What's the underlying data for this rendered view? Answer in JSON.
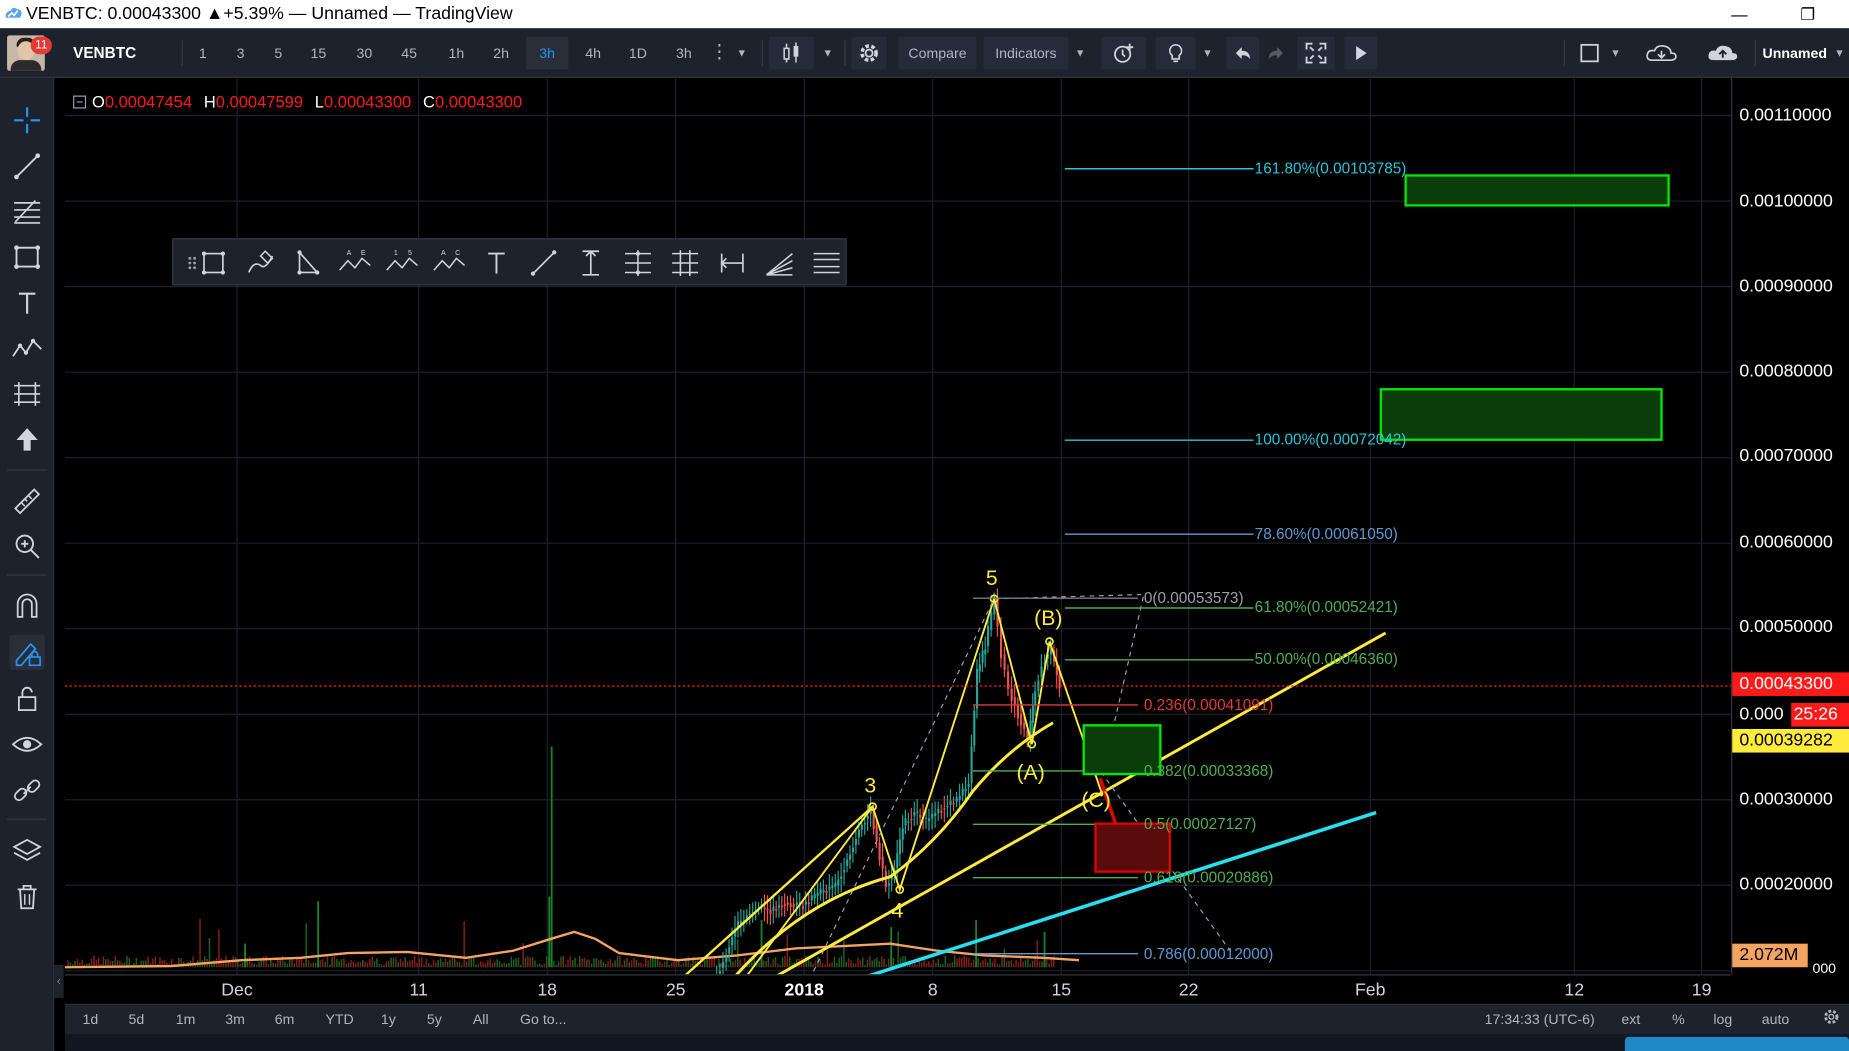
{
  "window": {
    "title": "VENBTC: 0.00043300 ▲+5.39% — Unnamed — TradingView",
    "minimize": "—",
    "restore": "❐"
  },
  "user": {
    "notifications": "11"
  },
  "toolbar": {
    "symbol": "VENBTC",
    "intervals": [
      "1",
      "3",
      "5",
      "15",
      "30",
      "45",
      "1h",
      "2h",
      "3h",
      "4h",
      "1D",
      "3h"
    ],
    "active_interval": "3h",
    "compare_label": "Compare",
    "indicators_label": "Indicators",
    "layout_name": "Unnamed"
  },
  "ohlc": {
    "o_label": "O",
    "o": "0.00047454",
    "h_label": "H",
    "h": "0.00047599",
    "l_label": "L",
    "l": "0.00043300",
    "c_label": "C",
    "c": "0.00043300"
  },
  "price_axis": {
    "labels": [
      "0.00110000",
      "0.00100000",
      "0.00090000",
      "0.00080000",
      "0.00070000",
      "0.00060000",
      "0.00050000",
      "0.00030000",
      "0.00020000"
    ],
    "current_price": "0.00043300",
    "countdown_price": "0.000",
    "countdown": "25:26",
    "ma_price": "0.00039282",
    "volume": "2.072M",
    "bottom_fragment": "000"
  },
  "time_axis": {
    "labels": [
      "Dec",
      "11",
      "18",
      "25",
      "2018",
      "8",
      "15",
      "22",
      "Feb",
      "12",
      "19"
    ]
  },
  "fib_extension": {
    "levels": [
      "161.80%(0.00103785)",
      "100.00%(0.00072042)",
      "78.60%(0.00061050)",
      "61.80%(0.00052421)",
      "50.00%(0.00046360)"
    ]
  },
  "fib_retracement": {
    "levels": [
      "0(0.00053573)",
      "0.236(0.00041091)",
      "0.382(0.00033368)",
      "0.5(0.00027127)",
      "0.618(0.00020886)",
      "0.786(0.00012000)"
    ]
  },
  "waves": {
    "labels": [
      "5",
      "3",
      "4",
      "(A)",
      "(B)",
      "(C)"
    ]
  },
  "bottom": {
    "ranges": [
      "1d",
      "5d",
      "1m",
      "3m",
      "6m",
      "YTD",
      "1y",
      "5y",
      "All"
    ],
    "goto": "Go to...",
    "clock": "17:34:33 (UTC-6)",
    "ext": "ext",
    "percent": "%",
    "log": "log",
    "auto": "auto"
  },
  "colors": {
    "background": "#000000",
    "panel": "#1e222d",
    "accent": "#2196f3",
    "trendline_yellow": "#ffeb3b",
    "trendline_cyan": "#26e0f0",
    "target_green": "#00e600",
    "target_red": "#e00000",
    "last_price": "#ff1a1a"
  },
  "icons": {
    "left_toolbar": [
      "crosshair-icon",
      "trend-line-icon",
      "fib-icon",
      "rectangle-icon",
      "text-icon",
      "pattern-icon",
      "prediction-icon",
      "arrow-up-icon",
      "ruler-icon",
      "zoom-icon",
      "magnet-icon",
      "stay-drawing-icon",
      "lock-icon",
      "eye-icon",
      "link-icon",
      "layers-icon",
      "trash-icon"
    ]
  }
}
